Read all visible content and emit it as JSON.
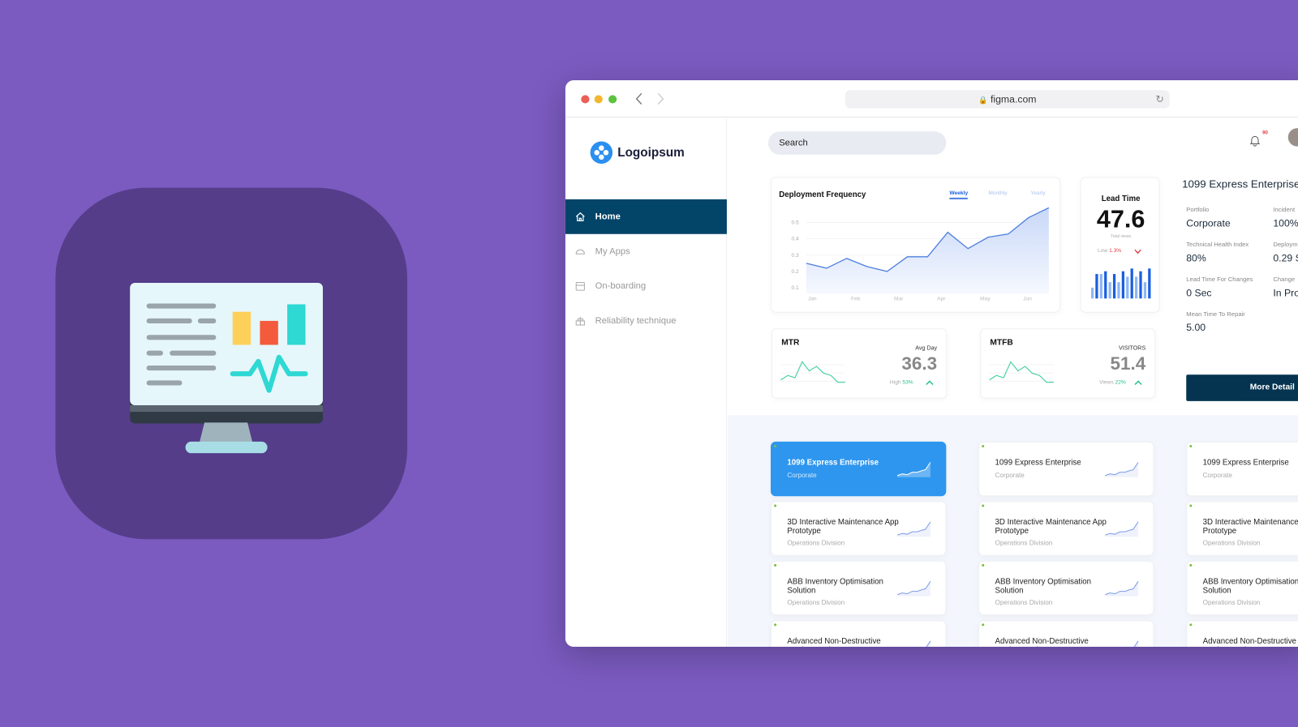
{
  "browser": {
    "url": "figma.com"
  },
  "sidebar": {
    "logo": "Logoipsum",
    "items": [
      {
        "label": "Home",
        "icon": "home-icon",
        "active": true
      },
      {
        "label": "My Apps",
        "icon": "gauge-icon"
      },
      {
        "label": "On-boarding",
        "icon": "calendar-icon"
      },
      {
        "label": "Reliability technique",
        "icon": "gift-icon"
      }
    ]
  },
  "header": {
    "search_placeholder": "Search",
    "notification_count": "90"
  },
  "deployment": {
    "title": "Deployment Frequency",
    "tabs": [
      "Weekly",
      "Monthly",
      "Yearly"
    ],
    "active_tab": "Weekly"
  },
  "chart_data": [
    {
      "type": "area",
      "title": "Deployment Frequency",
      "categories": [
        "Jan",
        "Feb",
        "Mar",
        "Apr",
        "May",
        "Jun"
      ],
      "yticks": [
        "0.1",
        "0.2",
        "0.3",
        "0.4",
        "0.5"
      ],
      "ylim": [
        0.05,
        0.6
      ],
      "values": [
        0.25,
        0.22,
        0.28,
        0.23,
        0.2,
        0.29,
        0.29,
        0.44,
        0.34,
        0.41,
        0.43,
        0.53,
        0.59
      ],
      "color": "#4f7fe0",
      "grid": true
    },
    {
      "type": "bar",
      "values": [
        4,
        9,
        9,
        10,
        6,
        9,
        6,
        10,
        8,
        11,
        8,
        10,
        6,
        11
      ],
      "colors": [
        "#8fb6f5",
        "#1a5fe0"
      ]
    },
    {
      "type": "line",
      "values": [
        1,
        2,
        1.5,
        5,
        3,
        4,
        2.5,
        2,
        0.5,
        0.5
      ],
      "color": "#3fd0a0"
    },
    {
      "type": "line",
      "values": [
        1,
        2,
        1.5,
        5,
        3,
        4,
        2.5,
        2,
        0.5,
        0.5
      ],
      "color": "#3fd0a0"
    }
  ],
  "lead_time": {
    "title": "Lead Time",
    "value": "47.6",
    "caption": "Total views",
    "low_label": "Low",
    "low_value": "1.3%"
  },
  "mtr": {
    "title": "MTR",
    "label": "Avg Day",
    "value": "36.3",
    "stat_label": "High",
    "stat_value": "53%"
  },
  "mtfb": {
    "title": "MTFB",
    "label": "VISITORS",
    "value": "51.4",
    "stat_label": "Views",
    "stat_value": "22%"
  },
  "details": {
    "title": "1099 Express Enterprise",
    "fields": [
      {
        "label": "Portfolio",
        "value": "Corporate"
      },
      {
        "label": "Incident",
        "value": "100%"
      },
      {
        "label": "Technical Health Index",
        "value": "80%"
      },
      {
        "label": "Deploym",
        "value": "0.29 S"
      },
      {
        "label": "Lead Time For Changes",
        "value": "0 Sec"
      },
      {
        "label": "Change",
        "value": "In Pro"
      },
      {
        "label": "Mean Time To Repair",
        "value": "5.00"
      }
    ],
    "button": "More Detail"
  },
  "apps": [
    {
      "name": "1099 Express Enterprise",
      "division": "Corporate"
    },
    {
      "name": "3D Interactive Maintenance App Prototype",
      "division": "Operations Division"
    },
    {
      "name": "ABB Inventory Optimisation Solution",
      "division": "Operations Division"
    },
    {
      "name": "Advanced Non-Destructive Testing Register",
      "division": ""
    }
  ],
  "colors": {
    "background": "#7b5bc0",
    "nav_active": "#034469",
    "accent": "#2e96ee",
    "positive": "#1fc08a",
    "negative": "#e0404a"
  }
}
